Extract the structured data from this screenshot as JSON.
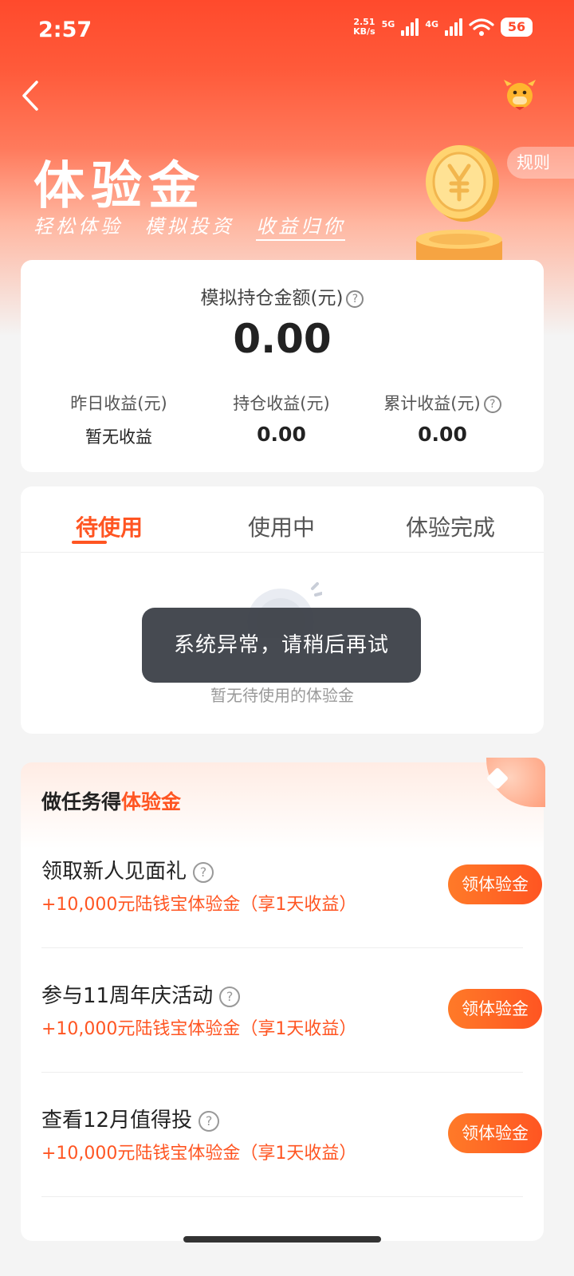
{
  "status_bar": {
    "time": "2:57",
    "net_speed_value": "2.51",
    "net_speed_unit": "KB/s",
    "sig1": "5G",
    "sig2": "4G",
    "battery": "56"
  },
  "header": {
    "title": "体验金",
    "subtitle": [
      "轻松体验",
      "模拟投资",
      "收益归你"
    ],
    "rules": "规则"
  },
  "asset": {
    "label": "模拟持仓金额(元)",
    "value": "0.00",
    "stats": [
      {
        "label": "昨日收益(元)",
        "value": "暂无收益"
      },
      {
        "label": "持仓收益(元)",
        "value": "0.00"
      },
      {
        "label": "累计收益(元)",
        "value": "0.00"
      }
    ]
  },
  "tabs": {
    "items": [
      "待使用",
      "使用中",
      "体验完成"
    ],
    "active": "待使用",
    "empty_text": "暂无待使用的体验金"
  },
  "toast": "系统异常，请稍后再试",
  "tasks": {
    "title_prefix": "做任务得",
    "title_highlight": "体验金",
    "items": [
      {
        "title": "领取新人见面礼",
        "reward": "+10,000元陆钱宝体验金（享1天收益）",
        "button": "领体验金"
      },
      {
        "title": "参与11周年庆活动",
        "reward": "+10,000元陆钱宝体验金（享1天收益）",
        "button": "领体验金"
      },
      {
        "title": "查看12月值得投",
        "reward": "+10,000元陆钱宝体验金（享1天收益）",
        "button": "领体验金"
      }
    ]
  },
  "colors": {
    "brand": "#ff4a2c",
    "accent": "#ff5522",
    "toast_bg": "#3c4048"
  },
  "icons": {
    "back": "chevron-left-icon",
    "mascot": "ox-mascot-icon",
    "help": "question-circle-icon"
  }
}
